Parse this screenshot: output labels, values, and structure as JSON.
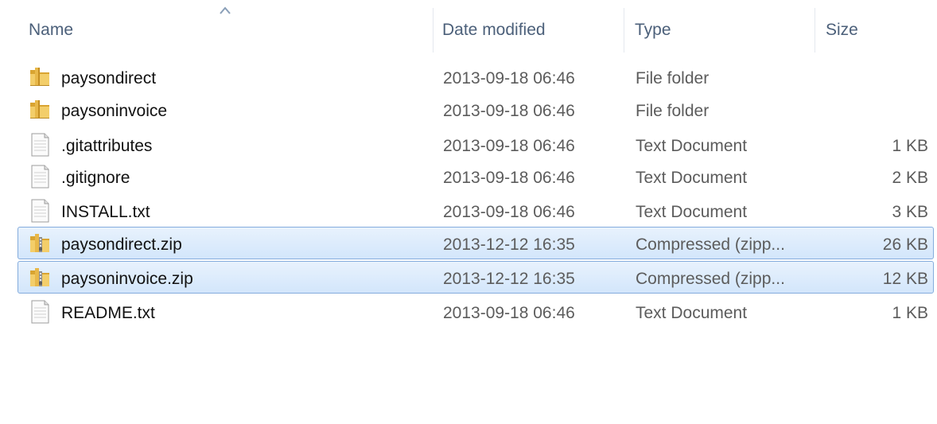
{
  "columns": {
    "name": "Name",
    "date_modified": "Date modified",
    "type": "Type",
    "size": "Size"
  },
  "sort_indicator": "sort-ascending-icon",
  "colors": {
    "selection_fill": "#d9e9fc",
    "selection_border": "#84acdd",
    "header_text": "#4c607a"
  },
  "files": [
    {
      "name": "paysondirect",
      "date": "2013-09-18 06:46",
      "type": "File folder",
      "size": "",
      "icon": "folder-icon",
      "selected": false
    },
    {
      "name": "paysoninvoice",
      "date": "2013-09-18 06:46",
      "type": "File folder",
      "size": "",
      "icon": "folder-icon",
      "selected": false
    },
    {
      "name": ".gitattributes",
      "date": "2013-09-18 06:46",
      "type": "Text Document",
      "size": "1 KB",
      "icon": "text-document-icon",
      "selected": false
    },
    {
      "name": ".gitignore",
      "date": "2013-09-18 06:46",
      "type": "Text Document",
      "size": "2 KB",
      "icon": "text-document-icon",
      "selected": false
    },
    {
      "name": "INSTALL.txt",
      "date": "2013-09-18 06:46",
      "type": "Text Document",
      "size": "3 KB",
      "icon": "text-document-icon",
      "selected": false
    },
    {
      "name": "paysondirect.zip",
      "date": "2013-12-12 16:35",
      "type": "Compressed (zipp...",
      "size": "26 KB",
      "icon": "zip-folder-icon",
      "selected": true
    },
    {
      "name": "paysoninvoice.zip",
      "date": "2013-12-12 16:35",
      "type": "Compressed (zipp...",
      "size": "12 KB",
      "icon": "zip-folder-icon",
      "selected": true
    },
    {
      "name": "README.txt",
      "date": "2013-09-18 06:46",
      "type": "Text Document",
      "size": "1 KB",
      "icon": "text-document-icon",
      "selected": false
    }
  ]
}
